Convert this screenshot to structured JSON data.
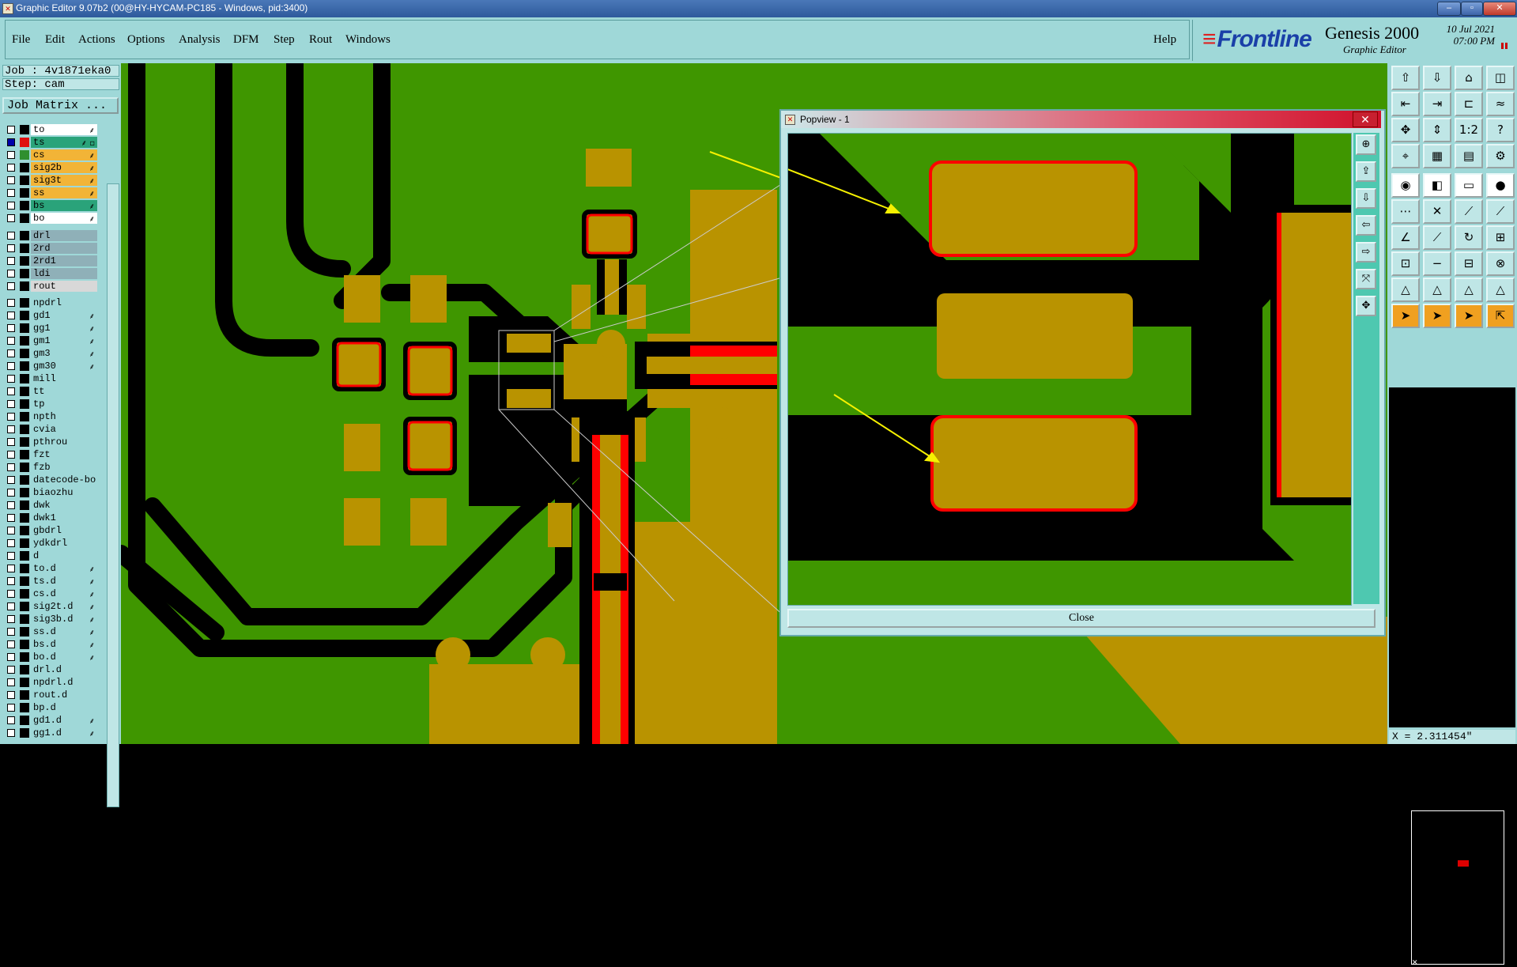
{
  "window": {
    "title": "Graphic Editor 9.07b2 (00@HY-HYCAM-PC185 - Windows, pid:3400)",
    "controls": [
      "–",
      "▫",
      "✕"
    ]
  },
  "menubar": {
    "items": [
      "File",
      "Edit",
      "Actions",
      "Options",
      "Analysis",
      "DFM",
      "Step",
      "Rout",
      "Windows"
    ],
    "help": "Help"
  },
  "brand": {
    "logo": "Frontline",
    "product": "Genesis 2000",
    "subtitle": "Graphic Editor",
    "date": "10 Jul 2021",
    "time": "07:00 PM"
  },
  "job": {
    "job_label": "Job : 4v1871eka0",
    "step_label": "Step: cam",
    "matrix_button": "Job Matrix ..."
  },
  "layers": [
    {
      "name": "to",
      "color": "#ffffff",
      "checked": false,
      "swatch": "#000000",
      "icon": "⸙"
    },
    {
      "name": "ts",
      "color": "#2aa37a",
      "checked": true,
      "swatch": "#e01010",
      "icon": "⸙ ▫"
    },
    {
      "name": "cs",
      "color": "#f2b437",
      "checked": false,
      "swatch": "#2f8f2f",
      "icon": "⸙"
    },
    {
      "name": "sig2b",
      "color": "#f2b437",
      "checked": false,
      "swatch": "#000000",
      "icon": "⸙"
    },
    {
      "name": "sig3t",
      "color": "#f2b437",
      "checked": false,
      "swatch": "#000000",
      "icon": "⸙"
    },
    {
      "name": "ss",
      "color": "#f2b437",
      "checked": false,
      "swatch": "#000000",
      "icon": "⸙"
    },
    {
      "name": "bs",
      "color": "#2aa37a",
      "checked": false,
      "swatch": "#000000",
      "icon": "⸙"
    },
    {
      "name": "bo",
      "color": "#ffffff",
      "checked": false,
      "swatch": "#000000",
      "icon": "⸙"
    },
    {
      "name": "drl",
      "color": "#8fb0b8",
      "checked": false,
      "swatch": "#000000",
      "icon": ""
    },
    {
      "name": "2rd",
      "color": "#8fb0b8",
      "checked": false,
      "swatch": "#000000",
      "icon": ""
    },
    {
      "name": "2rd1",
      "color": "#8fb0b8",
      "checked": false,
      "swatch": "#000000",
      "icon": ""
    },
    {
      "name": "ldi",
      "color": "#8fb0b8",
      "checked": false,
      "swatch": "#000000",
      "icon": ""
    },
    {
      "name": "rout",
      "color": "#d8d8d8",
      "checked": false,
      "swatch": "#000000",
      "icon": ""
    },
    {
      "name": "npdrl",
      "color": "#9fd8d8",
      "checked": false,
      "swatch": "#000000",
      "icon": ""
    },
    {
      "name": "gd1",
      "color": "#9fd8d8",
      "checked": false,
      "swatch": "#000000",
      "icon": "⸙"
    },
    {
      "name": "gg1",
      "color": "#9fd8d8",
      "checked": false,
      "swatch": "#000000",
      "icon": "⸙"
    },
    {
      "name": "gm1",
      "color": "#9fd8d8",
      "checked": false,
      "swatch": "#000000",
      "icon": "⸙"
    },
    {
      "name": "gm3",
      "color": "#9fd8d8",
      "checked": false,
      "swatch": "#000000",
      "icon": "⸙"
    },
    {
      "name": "gm30",
      "color": "#9fd8d8",
      "checked": false,
      "swatch": "#000000",
      "icon": "⸙"
    },
    {
      "name": "mill",
      "color": "#9fd8d8",
      "checked": false,
      "swatch": "#000000",
      "icon": ""
    },
    {
      "name": "tt",
      "color": "#9fd8d8",
      "checked": false,
      "swatch": "#000000",
      "icon": ""
    },
    {
      "name": "tp",
      "color": "#9fd8d8",
      "checked": false,
      "swatch": "#000000",
      "icon": ""
    },
    {
      "name": "npth",
      "color": "#9fd8d8",
      "checked": false,
      "swatch": "#000000",
      "icon": ""
    },
    {
      "name": "cvia",
      "color": "#9fd8d8",
      "checked": false,
      "swatch": "#000000",
      "icon": ""
    },
    {
      "name": "pthrou",
      "color": "#9fd8d8",
      "checked": false,
      "swatch": "#000000",
      "icon": ""
    },
    {
      "name": "fzt",
      "color": "#9fd8d8",
      "checked": false,
      "swatch": "#000000",
      "icon": ""
    },
    {
      "name": "fzb",
      "color": "#9fd8d8",
      "checked": false,
      "swatch": "#000000",
      "icon": ""
    },
    {
      "name": "datecode-bo",
      "color": "#9fd8d8",
      "checked": false,
      "swatch": "#000000",
      "icon": ""
    },
    {
      "name": "biaozhu",
      "color": "#9fd8d8",
      "checked": false,
      "swatch": "#000000",
      "icon": ""
    },
    {
      "name": "dwk",
      "color": "#9fd8d8",
      "checked": false,
      "swatch": "#000000",
      "icon": ""
    },
    {
      "name": "dwk1",
      "color": "#9fd8d8",
      "checked": false,
      "swatch": "#000000",
      "icon": ""
    },
    {
      "name": "gbdrl",
      "color": "#9fd8d8",
      "checked": false,
      "swatch": "#000000",
      "icon": ""
    },
    {
      "name": "ydkdrl",
      "color": "#9fd8d8",
      "checked": false,
      "swatch": "#000000",
      "icon": ""
    },
    {
      "name": "d",
      "color": "#9fd8d8",
      "checked": false,
      "swatch": "#000000",
      "icon": ""
    },
    {
      "name": "to.d",
      "color": "#9fd8d8",
      "checked": false,
      "swatch": "#000000",
      "icon": "⸙"
    },
    {
      "name": "ts.d",
      "color": "#9fd8d8",
      "checked": false,
      "swatch": "#000000",
      "icon": "⸙"
    },
    {
      "name": "cs.d",
      "color": "#9fd8d8",
      "checked": false,
      "swatch": "#000000",
      "icon": "⸙"
    },
    {
      "name": "sig2t.d",
      "color": "#9fd8d8",
      "checked": false,
      "swatch": "#000000",
      "icon": "⸙"
    },
    {
      "name": "sig3b.d",
      "color": "#9fd8d8",
      "checked": false,
      "swatch": "#000000",
      "icon": "⸙"
    },
    {
      "name": "ss.d",
      "color": "#9fd8d8",
      "checked": false,
      "swatch": "#000000",
      "icon": "⸙"
    },
    {
      "name": "bs.d",
      "color": "#9fd8d8",
      "checked": false,
      "swatch": "#000000",
      "icon": "⸙"
    },
    {
      "name": "bo.d",
      "color": "#9fd8d8",
      "checked": false,
      "swatch": "#000000",
      "icon": "⸙"
    },
    {
      "name": "drl.d",
      "color": "#9fd8d8",
      "checked": false,
      "swatch": "#000000",
      "icon": ""
    },
    {
      "name": "npdrl.d",
      "color": "#9fd8d8",
      "checked": false,
      "swatch": "#000000",
      "icon": ""
    },
    {
      "name": "rout.d",
      "color": "#9fd8d8",
      "checked": false,
      "swatch": "#000000",
      "icon": ""
    },
    {
      "name": "bp.d",
      "color": "#9fd8d8",
      "checked": false,
      "swatch": "#000000",
      "icon": ""
    },
    {
      "name": "gd1.d",
      "color": "#9fd8d8",
      "checked": false,
      "swatch": "#000000",
      "icon": "⸙"
    },
    {
      "name": "gg1.d",
      "color": "#9fd8d8",
      "checked": false,
      "swatch": "#000000",
      "icon": "⸙"
    }
  ],
  "popview": {
    "title": "Popview - 1",
    "close_button": "Close",
    "close_icon": "✕"
  },
  "toolbox_icons": [
    "open-icon",
    "save-icon",
    "home-icon",
    "frame-icon",
    "snap-left-icon",
    "snap-right-icon",
    "step-icon",
    "wave-icon",
    "fit-icon",
    "center-icon",
    "one-to-one-icon",
    "help-icon",
    "measure-icon",
    "grid-icon",
    "layers-icon",
    "settings-icon",
    "pad-icon",
    "route-icon",
    "ruler-icon",
    "dot-icon",
    "connect-icon",
    "cross-icon",
    "link-icon",
    "link-red-icon",
    "line-icon",
    "line-red-icon",
    "arc-icon",
    "edit-icon",
    "pad-add-icon",
    "minus-icon",
    "dimension-icon",
    "cluster-icon",
    "triangle-icon",
    "triangle-select-icon",
    "triangle-edit-icon",
    "triangle-move-icon",
    "pointer-icon",
    "select-icon",
    "select-red-icon",
    "cursor-icon"
  ],
  "status": {
    "coordinate": "X = 2.311454\""
  },
  "colors": {
    "board": "#3f9600",
    "copper": "#b99300",
    "clearance": "#000000",
    "highlight": "#ff0000",
    "panel": "#9fd8d8",
    "arrow": "#f6f100"
  }
}
